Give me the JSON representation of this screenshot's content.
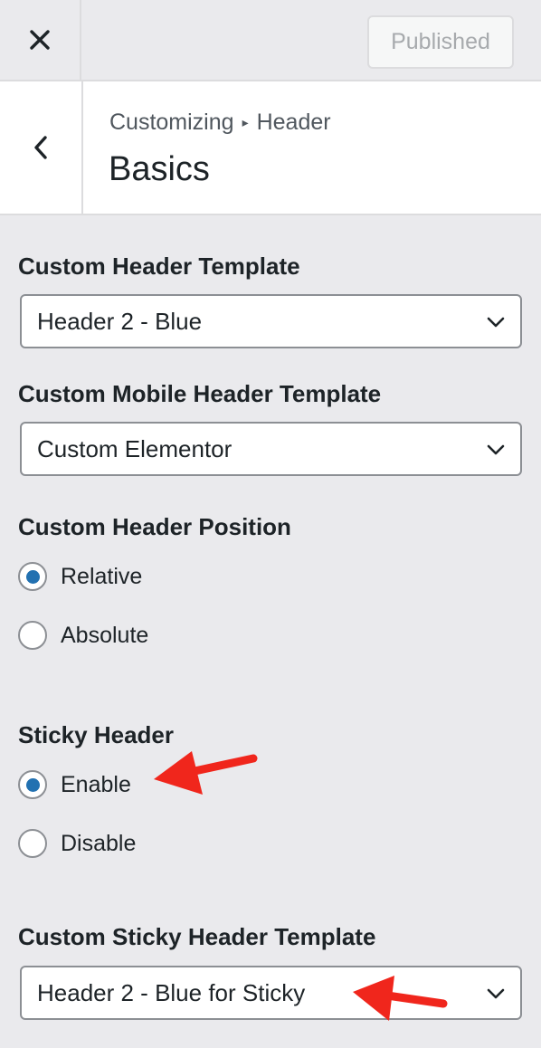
{
  "topbar": {
    "close_icon": "close-icon",
    "publish_label": "Published"
  },
  "section": {
    "back_icon": "chevron-left-icon",
    "breadcrumb_root": "Customizing",
    "breadcrumb_sep": "▸",
    "breadcrumb_parent": "Header",
    "title": "Basics"
  },
  "controls": {
    "header_template": {
      "label": "Custom Header Template",
      "value": "Header 2 - Blue"
    },
    "mobile_template": {
      "label": "Custom Mobile Header Template",
      "value": "Custom Elementor"
    },
    "position": {
      "label": "Custom Header Position",
      "options": [
        {
          "label": "Relative",
          "checked": true
        },
        {
          "label": "Absolute",
          "checked": false
        }
      ]
    },
    "sticky": {
      "label": "Sticky Header",
      "options": [
        {
          "label": "Enable",
          "checked": true
        },
        {
          "label": "Disable",
          "checked": false
        }
      ]
    },
    "sticky_template": {
      "label": "Custom Sticky Header Template",
      "value": "Header 2 - Blue for Sticky"
    }
  },
  "colors": {
    "accent": "#2271b1",
    "annotation_arrow": "#f0261c",
    "background": "#eaeaed"
  }
}
